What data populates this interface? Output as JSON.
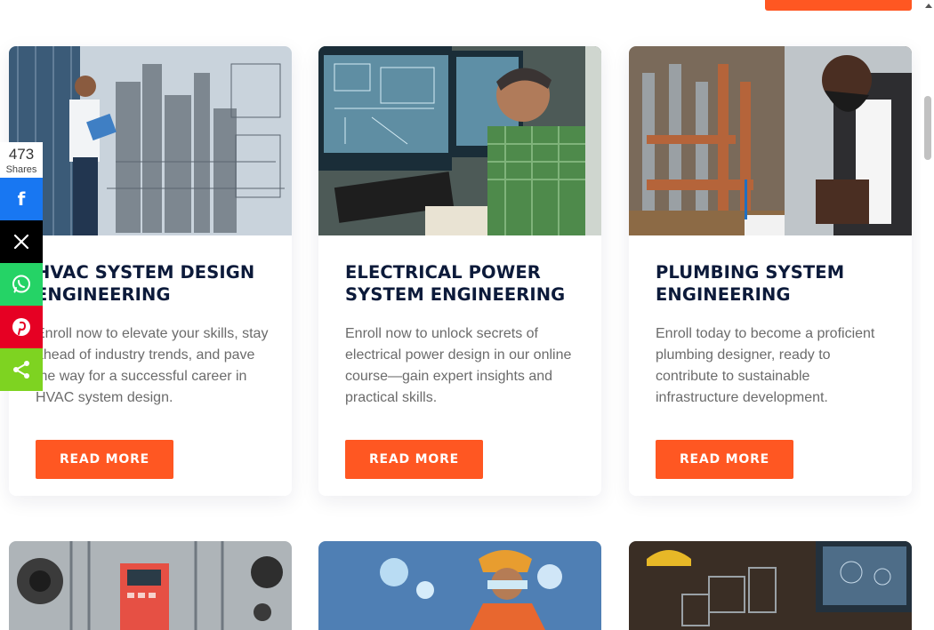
{
  "share": {
    "count": "473",
    "label": "Shares",
    "buttons": [
      {
        "network": "facebook",
        "icon": "facebook-icon",
        "color": "#1877f2",
        "glyph": "f"
      },
      {
        "network": "x",
        "icon": "x-icon",
        "color": "#000000",
        "glyph": "𝕏"
      },
      {
        "network": "whatsapp",
        "icon": "whatsapp-icon",
        "color": "#25d366"
      },
      {
        "network": "pinterest",
        "icon": "pinterest-icon",
        "color": "#e60023",
        "glyph": "P"
      },
      {
        "network": "share",
        "icon": "share-icon",
        "color": "#7ed321"
      }
    ]
  },
  "accent": "#ff5722",
  "cards": [
    {
      "title": "HVAC SYSTEM DESIGN ENGINEERING",
      "text": "Enroll now to elevate your skills, stay ahead of industry trends, and pave the way for a successful career in HVAC system design.",
      "button": "READ MORE"
    },
    {
      "title": "ELECTRICAL POWER SYSTEM ENGINEERING",
      "text": "Enroll now to unlock secrets of electrical power design in our online course—gain expert insights and practical skills.",
      "button": "READ MORE"
    },
    {
      "title": "PLUMBING SYSTEM ENGINEERING",
      "text": "Enroll today to become a proficient plumbing designer, ready to contribute to sustainable infrastructure development.",
      "button": "READ MORE"
    }
  ]
}
